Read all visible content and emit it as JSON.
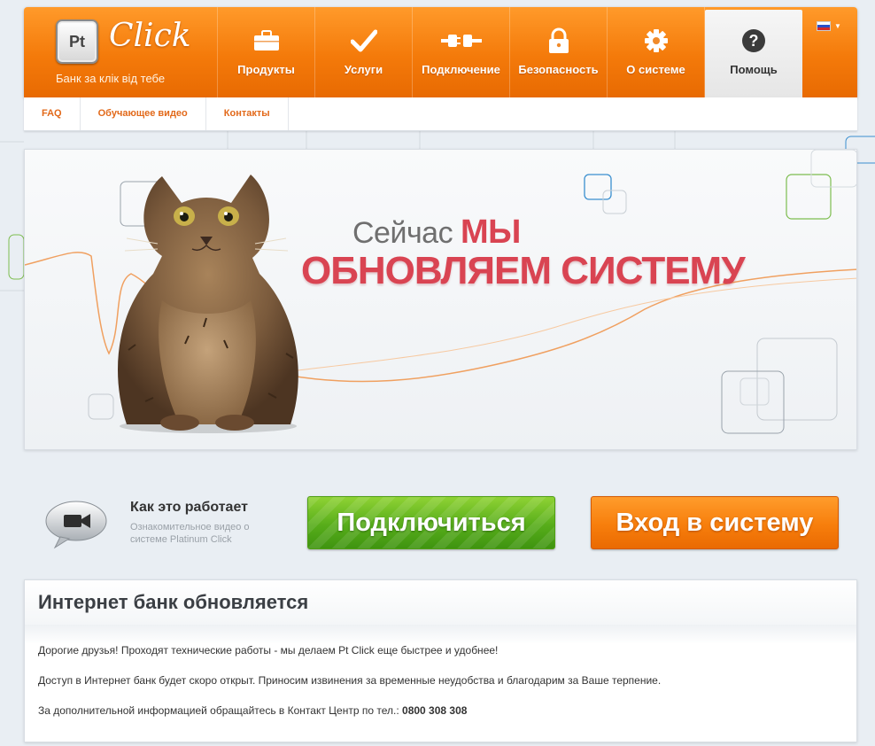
{
  "header": {
    "logo_mark": "Pt",
    "logo_word": "Click",
    "tagline": "Банк за клік від тебе",
    "nav": [
      {
        "label": "Продукты",
        "icon": "briefcase-icon"
      },
      {
        "label": "Услуги",
        "icon": "checkmark-icon"
      },
      {
        "label": "Подключение",
        "icon": "plug-icon"
      },
      {
        "label": "Безопасность",
        "icon": "padlock-icon"
      },
      {
        "label": "О системе",
        "icon": "gear-icon"
      },
      {
        "label": "Помощь",
        "icon": "question-icon",
        "active": true
      }
    ],
    "language_flag": "russian-flag-icon"
  },
  "submenu": [
    "FAQ",
    "Обучающее видео",
    "Контакты"
  ],
  "banner": {
    "line1_prefix": "Сейчас",
    "line1_emphasis": "МЫ",
    "line2": "ОБНОВЛЯЕМ СИСТЕМУ"
  },
  "how_it_works": {
    "title": "Как это работает",
    "subtitle": "Ознакомительное видео о системе Platinum Click",
    "icon": "video-camera-icon"
  },
  "buttons": {
    "connect": "Подключиться",
    "login": "Вход в систему"
  },
  "notice": {
    "title": "Интернет банк обновляется",
    "p1": "Дорогие друзья! Проходят технические работы - мы делаем Pt Click еще быстрее и удобнее!",
    "p2": "Доступ в Интернет банк будет скоро открыт. Приносим извинения за временные неудобства и благодарим за Ваше терпение.",
    "p3_text": "За дополнительной информацией обращайтесь в Контакт Центр по тел.:",
    "p3_phone": "0800 308 308"
  },
  "colors": {
    "brand_orange": "#f47a0a",
    "green_button": "#57ad1a",
    "headline_red": "#d94452"
  }
}
